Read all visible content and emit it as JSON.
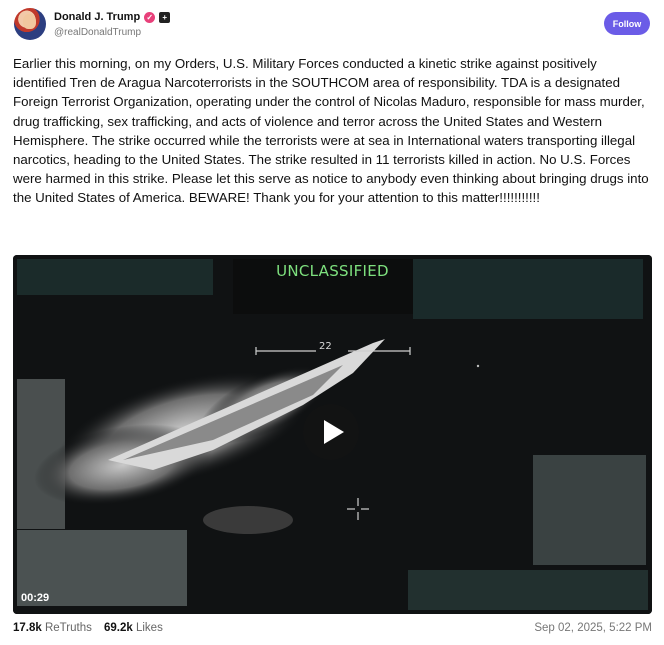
{
  "author": {
    "display_name": "Donald J. Trump",
    "handle": "@realDonaldTrump",
    "verified_icon": "verified-badge-icon",
    "truth_icon": "truth-social-icon"
  },
  "follow_label": "Follow",
  "post_text": "Earlier this morning, on my Orders, U.S. Military Forces conducted a kinetic strike against positively identified Tren de Aragua Narcoterrorists in the SOUTHCOM area of responsibility. TDA is a designated Foreign Terrorist Organization, operating under the control of Nicolas Maduro, responsible for mass murder, drug trafficking, sex trafficking, and acts of violence and terror across the United States and Western Hemisphere. The strike occurred while the terrorists were at sea in International waters transporting illegal narcotics, heading to the United States. The strike resulted in 11 terrorists killed in action. No U.S. Forces were harmed in this strike. Please let this serve as notice to anybody even thinking about bringing drugs into the United States of America. BEWARE! Thank you for your attention to this matter!!!!!!!!!!!",
  "video": {
    "overlay_label": "UNCLASSIFIED",
    "heading_readout": "22",
    "duration": "00:29",
    "play_icon": "play-icon"
  },
  "stats": {
    "retruths_count": "17.8k",
    "retruths_label": "ReTruths",
    "likes_count": "69.2k",
    "likes_label": "Likes"
  },
  "timestamp": "Sep 02, 2025, 5:22 PM",
  "colors": {
    "accent": "#6b5ce7",
    "overlay_green": "#7ee07e"
  }
}
